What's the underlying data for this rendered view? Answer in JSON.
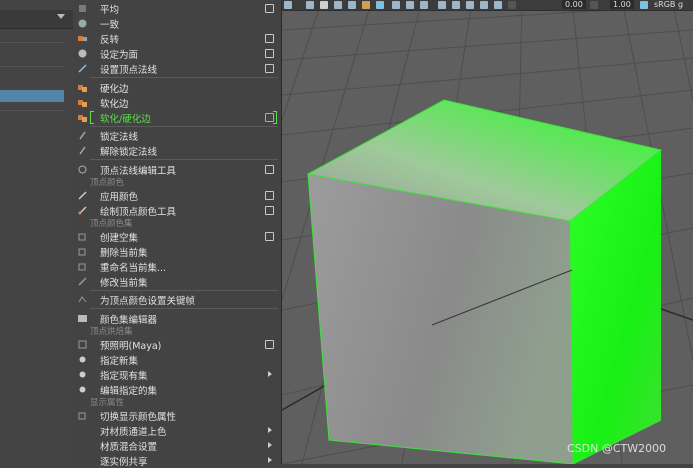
{
  "menu": {
    "items": [
      {
        "label": "平均",
        "checkbox": true
      },
      {
        "label": "一致",
        "checkbox": false
      },
      {
        "label": "反转",
        "checkbox": true
      },
      {
        "label": "设定为面",
        "checkbox": true
      },
      {
        "label": "设置顶点法线",
        "checkbox": true
      },
      {
        "label": "硬化边",
        "checkbox": false
      },
      {
        "label": "软化边",
        "checkbox": false
      },
      {
        "label": "软化/硬化边",
        "checkbox": true,
        "highlighted": true
      },
      {
        "label": "锁定法线",
        "checkbox": false
      },
      {
        "label": "解除锁定法线",
        "checkbox": false
      },
      {
        "label": "顶点法线编辑工具",
        "checkbox": true
      },
      {
        "label": "应用颜色",
        "checkbox": true
      },
      {
        "label": "绘制顶点颜色工具",
        "checkbox": true
      },
      {
        "label": "创建空集",
        "checkbox": true
      },
      {
        "label": "删除当前集",
        "checkbox": false
      },
      {
        "label": "重命名当前集...",
        "checkbox": false
      },
      {
        "label": "修改当前集",
        "checkbox": false
      },
      {
        "label": "为顶点颜色设置关键帧",
        "checkbox": false
      },
      {
        "label": "颜色集编辑器",
        "checkbox": false
      },
      {
        "label": "预照明(Maya)",
        "checkbox": true
      },
      {
        "label": "指定新集",
        "checkbox": false
      },
      {
        "label": "指定现有集",
        "submenu": true
      },
      {
        "label": "编辑指定的集",
        "checkbox": false
      },
      {
        "label": "切换显示颜色属性",
        "checkbox": false
      },
      {
        "label": "对材质通道上色",
        "submenu": true
      },
      {
        "label": "材质混合设置",
        "submenu": true
      },
      {
        "label": "逐实例共享",
        "submenu": true
      }
    ],
    "headers": [
      "顶点颜色",
      "顶点颜色集",
      "顶点烘焙集",
      "显示属性"
    ]
  },
  "toolbar": {
    "field1": "0.00",
    "field2": "1.00",
    "colorspace": "sRGB g"
  },
  "watermark": "CSDN @CTW2000",
  "colors": {
    "menu_bg": "#434343",
    "highlight_green": "#59e04a",
    "cube_green": "#22ff1e",
    "viewport_bg": "#5f5f5f"
  }
}
